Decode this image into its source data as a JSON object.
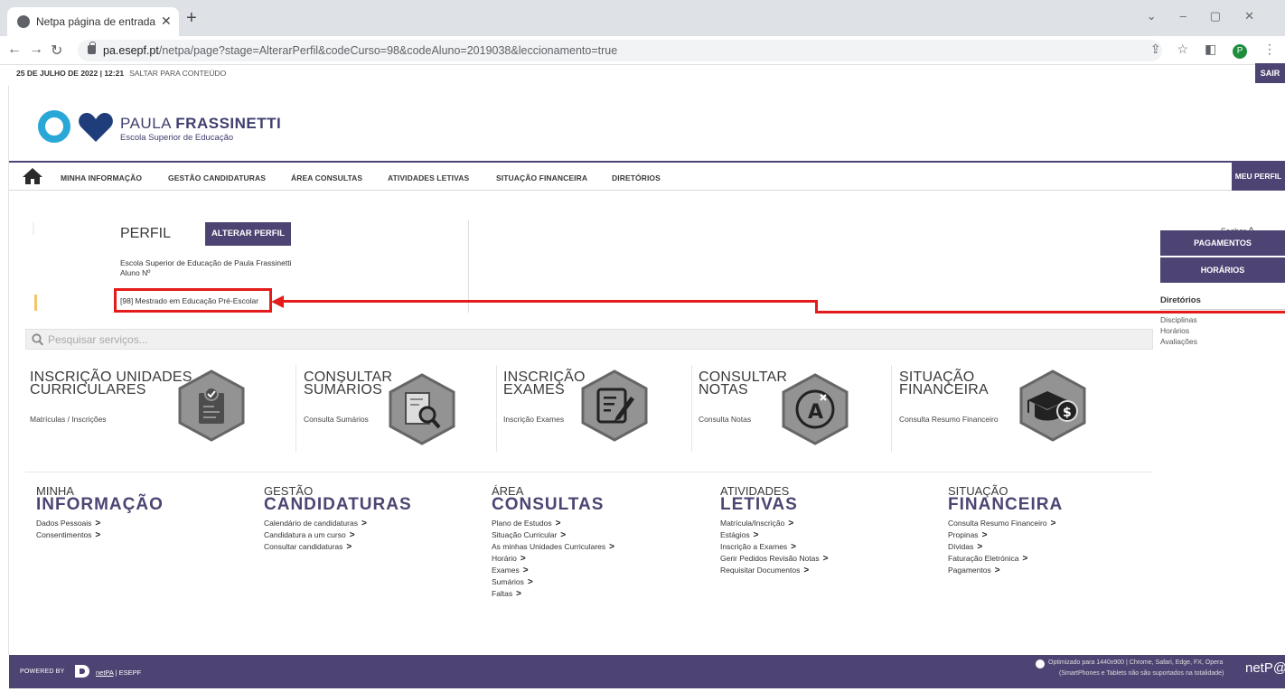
{
  "browser": {
    "tab_title": "Netpa página de entrada",
    "url_host": "pa.esepf.pt",
    "url_path": "/netpa/page?stage=AlterarPerfil&codeCurso=98&codeAluno=2019038&leccionamento=true",
    "profile_initial": "P"
  },
  "header": {
    "date": "25 DE JULHO DE 2022 | 12:21",
    "skip_link": "SALTAR PARA CONTEÚDO",
    "logout": "SAIR",
    "brand_first": "PAULA",
    "brand_second": "FRASSINETTI",
    "brand_sub": "Escola Superior de Educação"
  },
  "nav": {
    "items": [
      "MINHA INFORMAÇÃO",
      "GESTÃO CANDIDATURAS",
      "ÁREA CONSULTAS",
      "ATIVIDADES LETIVAS",
      "SITUAÇÃO FINANCEIRA",
      "DIRETÓRIOS"
    ],
    "profile_button": "MEU PERFIL",
    "close_label": "Fechar"
  },
  "profile": {
    "title": "PERFIL",
    "change_button": "ALTERAR PERFIL",
    "school": "Escola Superior de Educação de Paula Frassinetti",
    "student": "Aluno Nº",
    "course": "[98] Mestrado em Educação Pré-Escolar"
  },
  "sidebar": {
    "buttons": [
      "PAGAMENTOS",
      "HORÁRIOS"
    ],
    "directories_title": "Diretórios",
    "directories": [
      "Disciplinas",
      "Horários",
      "Avaliações"
    ]
  },
  "search": {
    "placeholder": "Pesquisar serviços..."
  },
  "tiles": [
    {
      "title1": "INSCRIÇÃO UNIDADES",
      "title2": "CURRICULARES",
      "link": "Matrículas / Inscrições",
      "icon": "clipboard-check-icon"
    },
    {
      "title1": "CONSULTAR",
      "title2": "SUMÁRIOS",
      "link": "Consulta Sumários",
      "icon": "document-search-icon"
    },
    {
      "title1": "INSCRIÇÃO",
      "title2": "EXAMES",
      "link": "Inscrição Exames",
      "icon": "edit-form-icon"
    },
    {
      "title1": "CONSULTAR",
      "title2": "NOTAS",
      "link": "Consulta Notas",
      "icon": "grade-icon"
    },
    {
      "title1": "SITUAÇÃO",
      "title2": "FINANCEIRA",
      "link": "Consulta Resumo Financeiro",
      "icon": "graduation-money-icon"
    }
  ],
  "columns": [
    {
      "top": "MINHA",
      "big": "INFORMAÇÃO",
      "links": [
        "Dados Pessoais",
        "Consentimentos"
      ]
    },
    {
      "top": "GESTÃO",
      "big": "CANDIDATURAS",
      "links": [
        "Calendário de candidaturas",
        "Candidatura a um curso",
        "Consultar candidaturas"
      ]
    },
    {
      "top": "ÁREA",
      "big": "CONSULTAS",
      "links": [
        "Plano de Estudos",
        "Situação Curricular",
        "As minhas Unidades Curriculares",
        "Horário",
        "Exames",
        "Sumários",
        "Faltas"
      ]
    },
    {
      "top": "ATIVIDADES",
      "big": "LETIVAS",
      "links": [
        "Matrícula/Inscrição",
        "Estágios",
        "Inscrição a Exames",
        "Gerir Pedidos Revisão Notas",
        "Requisitar Documentos"
      ]
    },
    {
      "top": "SITUAÇÃO",
      "big": "FINANCEIRA",
      "links": [
        "Consulta Resumo Financeiro",
        "Propinas",
        "Dívidas",
        "Faturação Eletrónica",
        "Pagamentos"
      ]
    }
  ],
  "footer": {
    "powered": "POWERED BY",
    "link": "netPA",
    "suffix": " | ESEPF",
    "opt_line1": "Optimizado para 1440x900 | Chrome, Safari, Edge, FX, Opera",
    "opt_line2": "(SmartPhones e Tablets não são suportados na totalidade)",
    "brand": "netP@"
  },
  "colors": {
    "accent": "#4e4473",
    "highlight": "#e31b1b",
    "logo_blue": "#29a8d8",
    "logo_navy": "#1f3d7a"
  }
}
